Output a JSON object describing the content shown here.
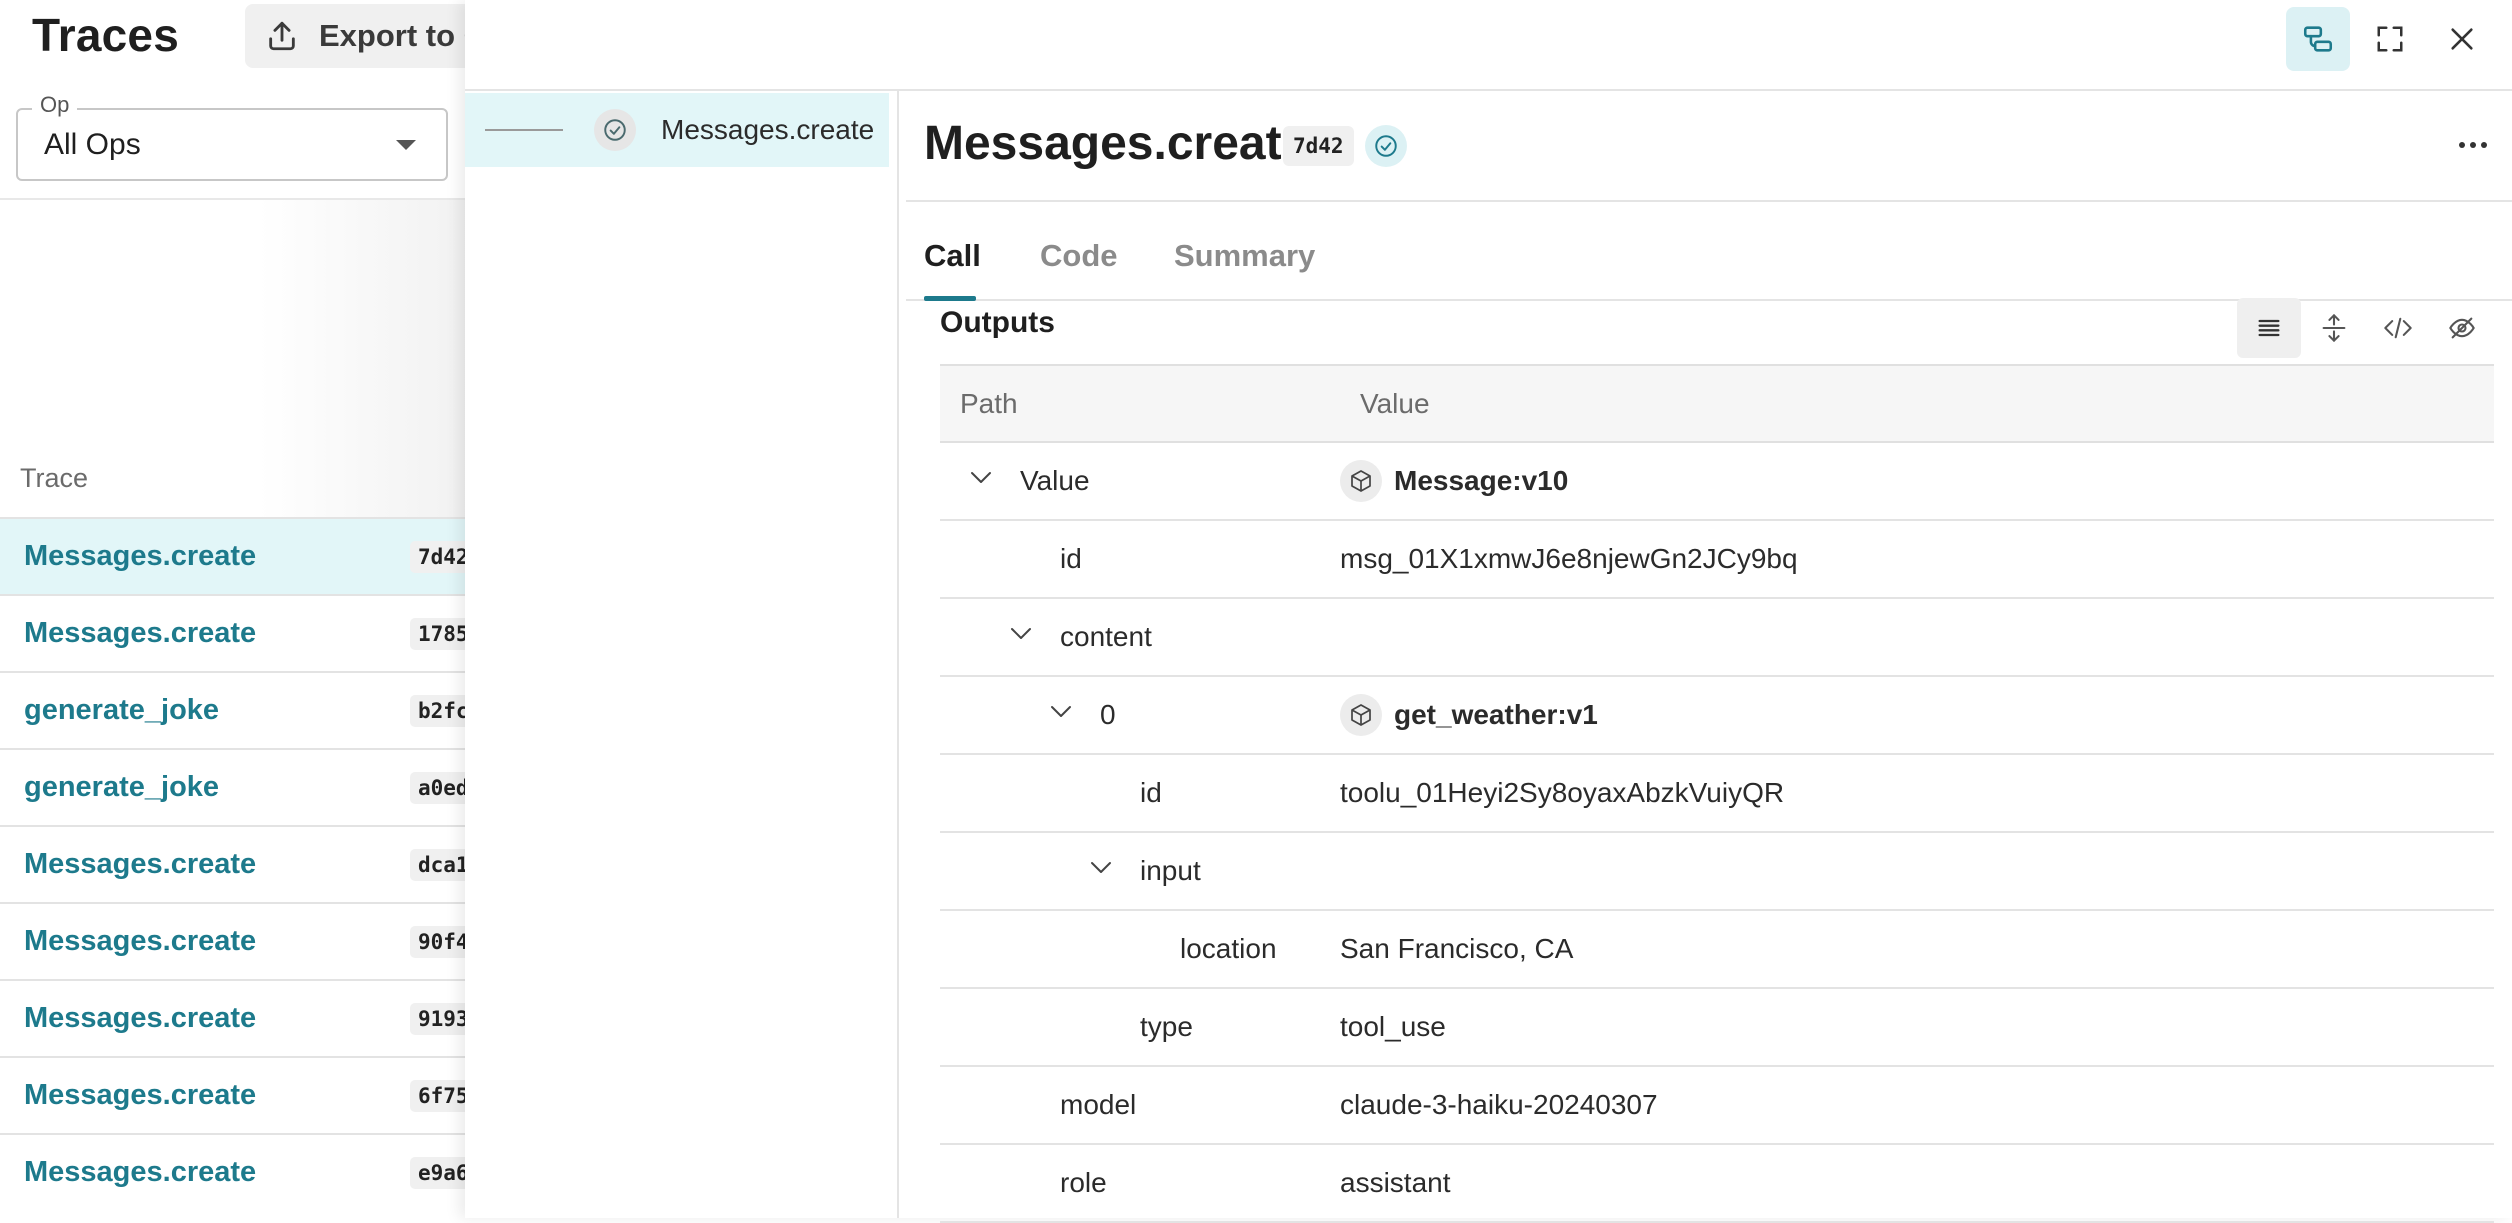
{
  "background_page": {
    "title": "Traces",
    "export_button": "Export to CSV",
    "op_filter": {
      "label": "Op",
      "value": "All Ops"
    },
    "trace_column": "Trace",
    "traces": [
      {
        "name": "Messages.create",
        "id": "7d42",
        "selected": true
      },
      {
        "name": "Messages.create",
        "id": "1785"
      },
      {
        "name": "generate_joke",
        "id": "b2fc"
      },
      {
        "name": "generate_joke",
        "id": "a0ed"
      },
      {
        "name": "Messages.create",
        "id": "dca1"
      },
      {
        "name": "Messages.create",
        "id": "90f4"
      },
      {
        "name": "Messages.create",
        "id": "9193"
      },
      {
        "name": "Messages.create",
        "id": "6f75"
      },
      {
        "name": "Messages.create",
        "id": "e9a6"
      }
    ]
  },
  "drawer": {
    "tree": {
      "label": "Messages.create"
    },
    "detail": {
      "title": "Messages.create",
      "badge": "7d42",
      "tabs": [
        "Call",
        "Code",
        "Summary"
      ],
      "active_tab": "Call",
      "section_title": "Outputs",
      "columns": {
        "path": "Path",
        "value": "Value"
      },
      "rows": [
        {
          "path": "Value",
          "value": "Message:v10",
          "object": true
        },
        {
          "path": "id",
          "value": "msg_01X1xmwJ6e8njewGn2JCy9bq"
        },
        {
          "path": "content",
          "value": ""
        },
        {
          "path": "0",
          "value": "get_weather:v1",
          "object": true
        },
        {
          "path": "id",
          "value": "toolu_01Heyi2Sy8oyaxAbzkVuiyQR"
        },
        {
          "path": "input",
          "value": ""
        },
        {
          "path": "location",
          "value": "San Francisco, CA"
        },
        {
          "path": "type",
          "value": "tool_use"
        },
        {
          "path": "model",
          "value": "claude-3-haiku-20240307"
        },
        {
          "path": "role",
          "value": "assistant"
        }
      ]
    }
  },
  "icons": [
    "upload-icon",
    "caret-down-icon",
    "trace-tree-icon",
    "fullscreen-icon",
    "close-icon",
    "check-circle-icon",
    "more-horizontal-icon",
    "list-view-icon",
    "expand-vertical-icon",
    "code-icon",
    "eye-off-icon",
    "chevron-down-icon",
    "cube-icon"
  ],
  "colors": {
    "accent": "#1d7a8c",
    "selected_bg": "#e2f6f8",
    "badge_bg": "#f0f0f0"
  }
}
